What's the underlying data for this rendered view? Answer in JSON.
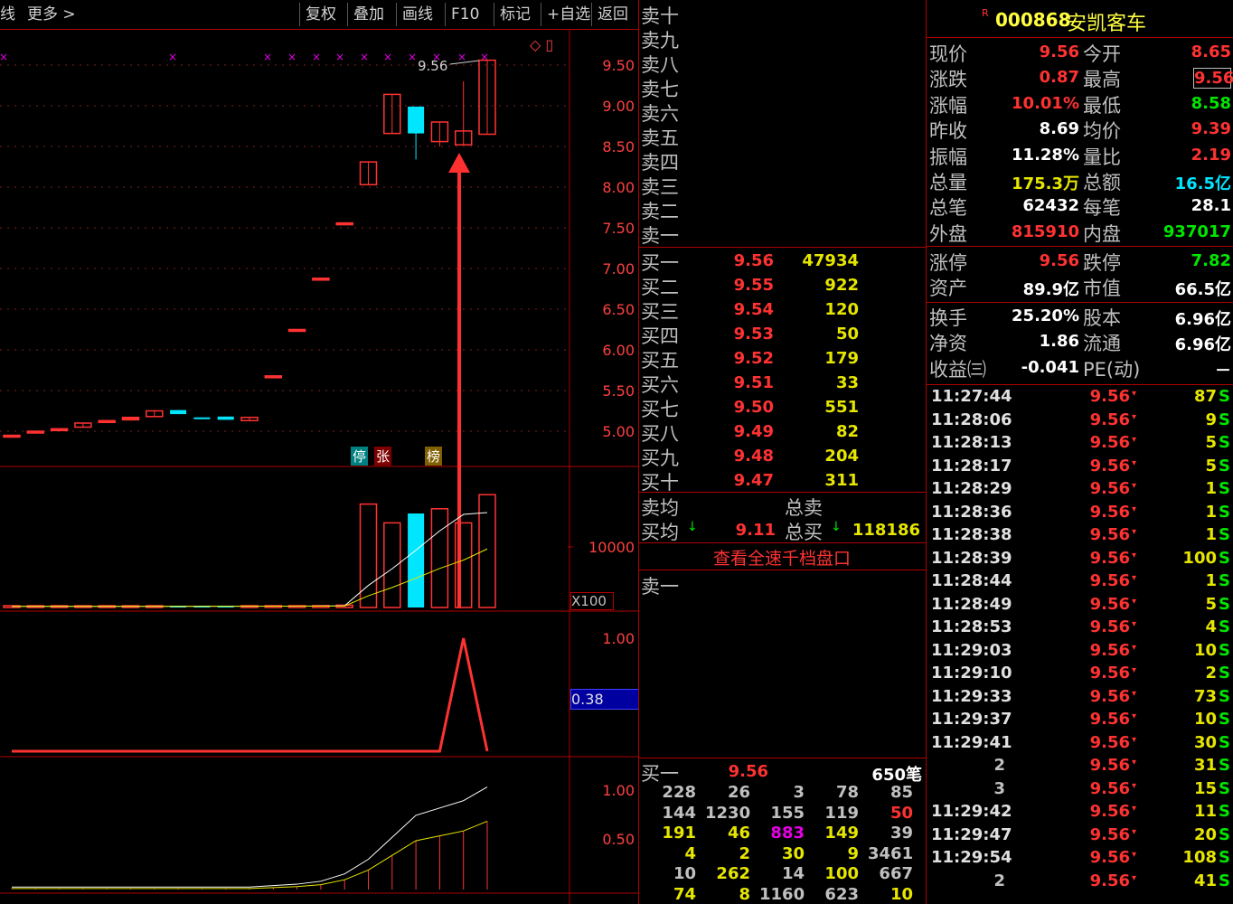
{
  "toolbar": {
    "left_label": "线",
    "more_label": "更多 >",
    "buttons": [
      "复权",
      "叠加",
      "画线",
      "F10",
      "标记",
      "+自选",
      "返回"
    ]
  },
  "chart_data": [
    {
      "type": "candlestick",
      "title": "",
      "y_ticks": [
        "9.50",
        "9.00",
        "8.50",
        "8.00",
        "7.50",
        "7.00",
        "6.50",
        "6.00",
        "5.50",
        "5.00"
      ],
      "annotation": "9.56",
      "markers": [
        "停",
        "张",
        "榜"
      ],
      "candles": [
        {
          "o": 4.93,
          "c": 4.95,
          "h": 4.95,
          "l": 4.93
        },
        {
          "o": 4.98,
          "c": 5.0,
          "h": 5.0,
          "l": 4.98
        },
        {
          "o": 5.01,
          "c": 5.03,
          "h": 5.03,
          "l": 5.0
        },
        {
          "o": 5.05,
          "c": 5.1,
          "h": 5.1,
          "l": 5.05
        },
        {
          "o": 5.12,
          "c": 5.13,
          "h": 5.14,
          "l": 5.12
        },
        {
          "o": 5.14,
          "c": 5.17,
          "h": 5.17,
          "l": 5.14
        },
        {
          "o": 5.18,
          "c": 5.25,
          "h": 5.25,
          "l": 5.18
        },
        {
          "o": 5.26,
          "c": 5.21,
          "h": 5.26,
          "l": 5.21
        },
        {
          "o": 5.17,
          "c": 5.15,
          "h": 5.17,
          "l": 5.15
        },
        {
          "o": 5.18,
          "c": 5.14,
          "h": 5.18,
          "l": 5.14
        },
        {
          "o": 5.13,
          "c": 5.17,
          "h": 5.17,
          "l": 5.13
        },
        {
          "o": 5.68,
          "c": 5.68,
          "h": 5.68,
          "l": 5.68
        },
        {
          "o": 6.25,
          "c": 6.25,
          "h": 6.25,
          "l": 6.25
        },
        {
          "o": 6.88,
          "c": 6.88,
          "h": 6.88,
          "l": 6.88
        },
        {
          "o": 7.56,
          "c": 7.56,
          "h": 7.56,
          "l": 7.56
        },
        {
          "o": 8.03,
          "c": 8.31,
          "h": 8.31,
          "l": 8.03
        },
        {
          "o": 8.66,
          "c": 9.14,
          "h": 9.14,
          "l": 8.66
        },
        {
          "o": 8.99,
          "c": 8.66,
          "h": 8.99,
          "l": 8.34
        },
        {
          "o": 8.56,
          "c": 8.8,
          "h": 8.8,
          "l": 8.5
        },
        {
          "o": 8.52,
          "c": 8.69,
          "h": 9.3,
          "l": 8.52
        },
        {
          "o": 8.65,
          "c": 9.56,
          "h": 9.56,
          "l": 8.65
        }
      ]
    },
    {
      "type": "bar",
      "title": "",
      "y_ticks": [
        "10000"
      ],
      "unit_label": "X100",
      "values": [
        120,
        120,
        130,
        110,
        120,
        130,
        120,
        140,
        130,
        150,
        130,
        150,
        150,
        200,
        250,
        11000,
        9000,
        10000,
        10500,
        9000,
        12000
      ]
    },
    {
      "type": "line",
      "title": "",
      "y_ticks": [
        "1.00"
      ],
      "current_value": "0.38",
      "values": [
        0,
        0,
        0,
        0,
        0,
        0,
        0,
        0,
        0,
        0,
        0,
        0,
        0,
        0,
        0,
        0,
        0,
        0,
        0,
        1.0,
        0
      ]
    },
    {
      "type": "bar",
      "title": "",
      "y_ticks": [
        "1.00",
        "0.50"
      ],
      "values": [
        0.01,
        0.01,
        0.01,
        0.01,
        0.01,
        0.01,
        0.01,
        0.01,
        0.01,
        0.01,
        0.01,
        0.02,
        0.03,
        0.05,
        0.1,
        0.2,
        0.35,
        0.5,
        0.55,
        0.6,
        0.7
      ]
    }
  ],
  "orderbook": {
    "sell_labels": [
      "卖十",
      "卖九",
      "卖八",
      "卖七",
      "卖六",
      "卖五",
      "卖四",
      "卖三",
      "卖二",
      "卖一"
    ],
    "buy_labels": [
      "买一",
      "买二",
      "买三",
      "买四",
      "买五",
      "买六",
      "买七",
      "买八",
      "买九",
      "买十"
    ],
    "buy_prices": [
      "9.56",
      "9.55",
      "9.54",
      "9.53",
      "9.52",
      "9.51",
      "9.50",
      "9.49",
      "9.48",
      "9.47"
    ],
    "buy_vols": [
      "47934",
      "922",
      "120",
      "50",
      "179",
      "33",
      "551",
      "82",
      "204",
      "311"
    ],
    "sell_avg_label": "卖均",
    "buy_avg_label": "买均",
    "buy_avg": "9.11",
    "total_sell_label": "总卖",
    "total_buy_label": "总买",
    "total_buy": "118186",
    "link": "查看全速千档盘口",
    "sell1_label": "卖一",
    "bid1_label": "买一",
    "bid1_price": "9.56",
    "bid1_count": "650笔",
    "queue": [
      [
        "228",
        "26",
        "3",
        "78",
        "85"
      ],
      [
        "144",
        "1230",
        "155",
        "119",
        "50"
      ],
      [
        "191",
        "46",
        "883",
        "149",
        "39"
      ],
      [
        "4",
        "2",
        "30",
        "9",
        "3461"
      ],
      [
        "10",
        "262",
        "14",
        "100",
        "667"
      ],
      [
        "74",
        "8",
        "1160",
        "623",
        "10"
      ]
    ]
  },
  "quote": {
    "badge": "R",
    "code": "000868",
    "name": "安凯客车",
    "rows": [
      [
        "现价",
        "9.56",
        "今开",
        "8.65"
      ],
      [
        "涨跌",
        "0.87",
        "最高",
        "9.56"
      ],
      [
        "涨幅",
        "10.01%",
        "最低",
        "8.58"
      ],
      [
        "昨收",
        "8.69",
        "均价",
        "9.39"
      ],
      [
        "振幅",
        "11.28%",
        "量比",
        "2.19"
      ],
      [
        "总量",
        "175.3万",
        "总额",
        "16.5亿"
      ],
      [
        "总笔",
        "62432",
        "每笔",
        "28.1"
      ],
      [
        "外盘",
        "815910",
        "内盘",
        "937017"
      ]
    ],
    "rows2": [
      [
        "涨停",
        "9.56",
        "跌停",
        "7.82"
      ],
      [
        "资产",
        "89.9亿",
        "市值",
        "66.5亿"
      ]
    ],
    "rows3": [
      [
        "换手",
        "25.20%",
        "股本",
        "6.96亿"
      ],
      [
        "净资",
        "1.86",
        "流通",
        "6.96亿"
      ],
      [
        "收益㈢",
        "-0.041",
        "PE(动)",
        "－"
      ]
    ]
  },
  "ticks": [
    [
      "11:27:44",
      "9.56",
      "87",
      "S"
    ],
    [
      "11:28:06",
      "9.56",
      "9",
      "S"
    ],
    [
      "11:28:13",
      "9.56",
      "5",
      "S"
    ],
    [
      "11:28:17",
      "9.56",
      "5",
      "S"
    ],
    [
      "11:28:29",
      "9.56",
      "1",
      "S"
    ],
    [
      "11:28:36",
      "9.56",
      "1",
      "S"
    ],
    [
      "11:28:38",
      "9.56",
      "1",
      "S"
    ],
    [
      "11:28:39",
      "9.56",
      "100",
      "S"
    ],
    [
      "11:28:44",
      "9.56",
      "1",
      "S"
    ],
    [
      "11:28:49",
      "9.56",
      "5",
      "S"
    ],
    [
      "11:28:53",
      "9.56",
      "4",
      "S"
    ],
    [
      "11:29:03",
      "9.56",
      "10",
      "S"
    ],
    [
      "11:29:10",
      "9.56",
      "2",
      "S"
    ],
    [
      "11:29:33",
      "9.56",
      "73",
      "S"
    ],
    [
      "11:29:37",
      "9.56",
      "10",
      "S"
    ],
    [
      "11:29:41",
      "9.56",
      "30",
      "S"
    ],
    [
      "2",
      "9.56",
      "31",
      "S"
    ],
    [
      "3",
      "9.56",
      "15",
      "S"
    ],
    [
      "11:29:42",
      "9.56",
      "11",
      "S"
    ],
    [
      "11:29:47",
      "9.56",
      "20",
      "S"
    ],
    [
      "11:29:54",
      "9.56",
      "108",
      "S"
    ],
    [
      "2",
      "9.56",
      "41",
      "S"
    ]
  ],
  "colors": {
    "up": "#ff3232",
    "down": "#00e6ff",
    "grid": "#b00000",
    "ma5": "#ffffff",
    "ma10": "#e6e600"
  }
}
